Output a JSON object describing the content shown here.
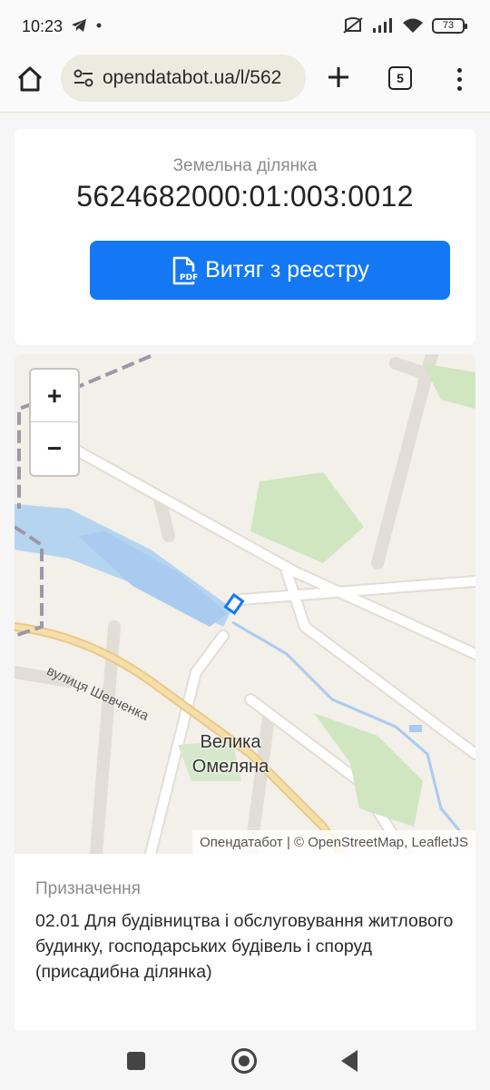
{
  "status": {
    "time": "10:23",
    "battery": "73"
  },
  "browser": {
    "url": "opendatabot.ua/l/562",
    "tab_count": "5"
  },
  "plot": {
    "label": "Земельна ділянка",
    "cadastral_number": "5624682000:01:003:0012",
    "extract_button": "Витяг з реєстру",
    "pdf_icon_text": "PDF"
  },
  "map": {
    "zoom_in": "+",
    "zoom_out": "−",
    "place_line1": "Велика",
    "place_line2": "Омеляна",
    "street": "вулиця Шевченка",
    "attribution": "Опендатабот | © OpenStreetMap, LeafletJS"
  },
  "purpose": {
    "label": "Призначення",
    "text": "02.01 Для будівництва і обслуговування житлового будинку, господарських будівель і споруд (присадибна ділянка)"
  }
}
